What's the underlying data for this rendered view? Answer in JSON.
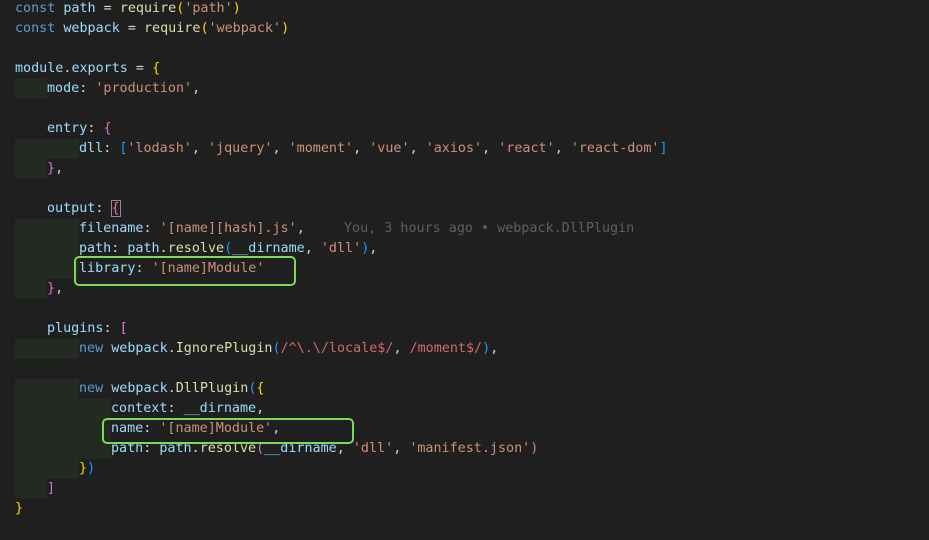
{
  "editor": {
    "lines": [
      [
        "const",
        " ",
        "path",
        " = ",
        "require",
        "(",
        "'path'",
        ")"
      ],
      [
        "const",
        " ",
        "webpack",
        " = ",
        "require",
        "(",
        "'webpack'",
        ")"
      ],
      [],
      [
        "module",
        ".",
        "exports",
        " = ",
        "{"
      ],
      [
        "mode",
        ": ",
        "'production'",
        ","
      ],
      [],
      [
        "entry",
        ": ",
        "{"
      ],
      [
        "dll",
        ": ",
        "[",
        "'lodash'",
        ", ",
        "'jquery'",
        ", ",
        "'moment'",
        ", ",
        "'vue'",
        ", ",
        "'axios'",
        ", ",
        "'react'",
        ", ",
        "'react-dom'",
        "]"
      ],
      [
        "}",
        ","
      ],
      [],
      [
        "output",
        ": ",
        "{"
      ],
      [
        "filename",
        ": ",
        "'[name][hash].js'",
        ","
      ],
      [
        "path",
        ": ",
        "path",
        ".",
        "resolve",
        "(",
        "__dirname",
        ", ",
        "'dll'",
        ")",
        ","
      ],
      [
        "library",
        ": ",
        "'[name]Module'"
      ],
      [
        "}",
        ","
      ],
      [],
      [
        "plugins",
        ": ",
        "["
      ],
      [
        "new",
        " ",
        "webpack",
        ".",
        "IgnorePlugin",
        "(",
        "/^\\.\\/locale$/",
        ", ",
        "/moment$/",
        ")",
        ","
      ],
      [],
      [
        "new",
        " ",
        "webpack",
        ".",
        "DllPlugin",
        "(",
        "{"
      ],
      [
        "context",
        ": ",
        "__dirname",
        ","
      ],
      [
        "name",
        ": ",
        "'[name]Module'",
        ","
      ],
      [
        "path",
        ": ",
        "path",
        ".",
        "resolve",
        "(",
        "__dirname",
        ", ",
        "'dll'",
        ", ",
        "'manifest.json'",
        ")"
      ],
      [
        "}",
        ")"
      ],
      [
        "]"
      ],
      [
        "}"
      ]
    ],
    "blame_annotation": "You, 3 hours ago • webpack.DllPlugin"
  },
  "colors": {
    "background": "#1f1f1f",
    "keyword": "#569cd6",
    "function": "#dcdcaa",
    "variable": "#9cdcfe",
    "string": "#ce9178",
    "highlight_box": "#7ed957"
  }
}
